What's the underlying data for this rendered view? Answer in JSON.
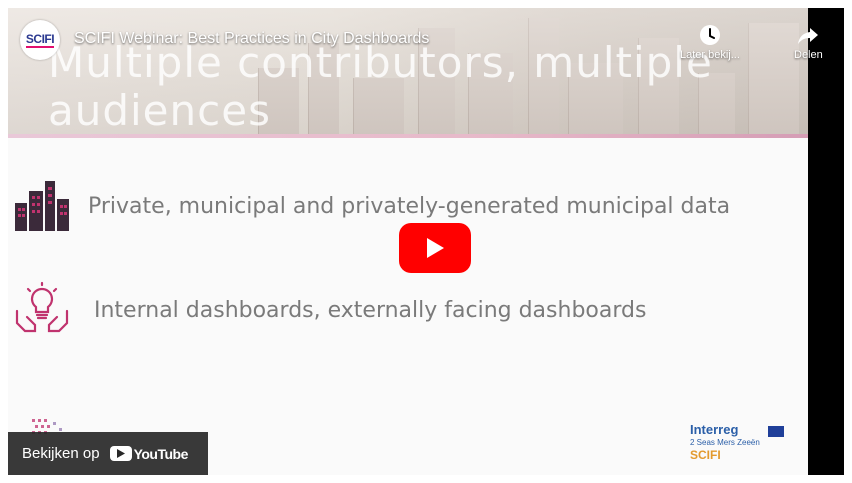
{
  "video": {
    "title": "SCIFI Webinar: Best Practices in City Dashboards",
    "channel_logo_text": "SCIFI",
    "watch_later_label": "Later bekij...",
    "share_label": "Delen",
    "watch_on_label": "Bekijken op",
    "youtube_label": "YouTube",
    "play_icon": "play-icon"
  },
  "slide": {
    "title_line1": "Multiple contributors, multiple",
    "title_line2": "audiences",
    "bullets": [
      {
        "icon": "city-buildings-icon",
        "text": "Private, municipal and privately-generated municipal data"
      },
      {
        "icon": "lightbulb-hands-icon",
        "text": "Internal dashboards, externally facing dashboards"
      }
    ],
    "footer_logo": {
      "name": "Interreg",
      "sub": "2 Seas Mers Zeeën",
      "project": "SCIFI"
    }
  },
  "colors": {
    "play_red": "#ff0000",
    "icon_pink": "#c0336e",
    "interreg_blue": "#2b5fa8",
    "scifi_orange": "#e39a2e"
  }
}
